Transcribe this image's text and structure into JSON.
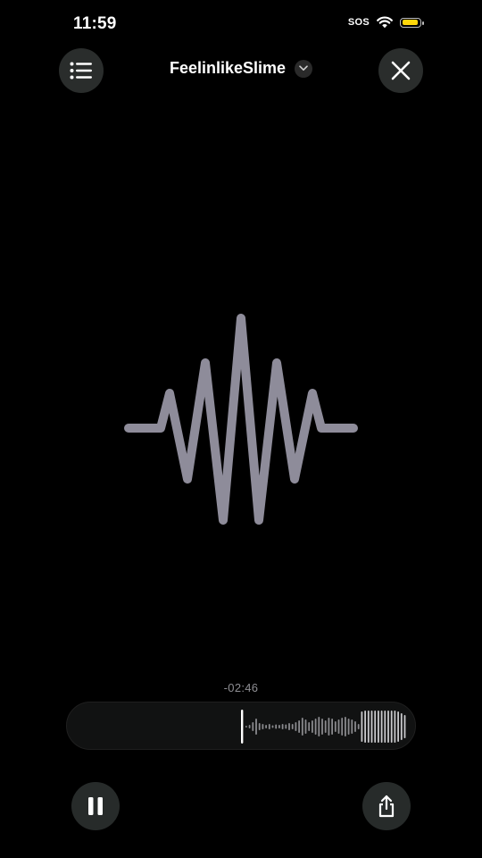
{
  "status": {
    "time": "11:59",
    "sos": "SOS",
    "icons": [
      "wifi-icon",
      "battery-icon"
    ],
    "battery_color": "#ffd60a"
  },
  "header": {
    "title": "FeelinlikeSlime",
    "icons": [
      "list-icon",
      "chevron-down-icon",
      "close-icon"
    ]
  },
  "visualizer": {
    "icon": "waveform-icon",
    "color": "#8e8c9a"
  },
  "playback": {
    "time_remaining": "-02:46",
    "played_fraction": 0.5
  },
  "controls": {
    "icons": [
      "pause-icon",
      "share-icon"
    ]
  }
}
